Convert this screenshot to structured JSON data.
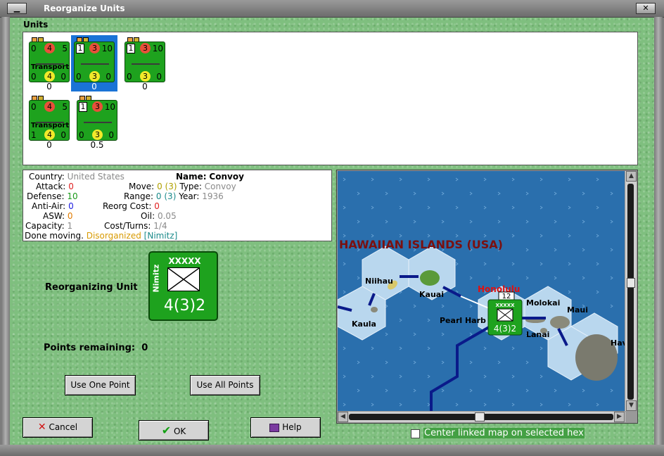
{
  "window": {
    "title": "Reorganize Units",
    "minimize_glyph": "▁",
    "close_glyph": "✕"
  },
  "units": {
    "label": "Units",
    "counters": [
      {
        "top_left": "0",
        "attack": "4",
        "move": "5",
        "name": "Transport",
        "bottom_left": "0",
        "defense": "4",
        "bottom_right": "0",
        "value": "0",
        "boxed": false,
        "selected": false
      },
      {
        "top_left": "1",
        "attack": "3",
        "move": "10",
        "name": "",
        "bottom_left": "0",
        "defense": "3",
        "bottom_right": "0",
        "value": "0",
        "boxed": true,
        "selected": true
      },
      {
        "top_left": "1",
        "attack": "3",
        "move": "10",
        "name": "",
        "bottom_left": "0",
        "defense": "3",
        "bottom_right": "0",
        "value": "0",
        "boxed": true,
        "selected": false
      },
      {
        "top_left": "0",
        "attack": "4",
        "move": "5",
        "name": "Transport",
        "bottom_left": "1",
        "defense": "4",
        "bottom_right": "0",
        "value": "0",
        "boxed": false,
        "selected": false
      },
      {
        "top_left": "1",
        "attack": "3",
        "move": "10",
        "name": "",
        "bottom_left": "0",
        "defense": "3",
        "bottom_right": "0",
        "value": "0.5",
        "boxed": true,
        "selected": false
      }
    ]
  },
  "info": {
    "country_label": "Country:",
    "country": "United States",
    "attack_label": "Attack:",
    "attack": "0",
    "defense_label": "Defense:",
    "defense": "10",
    "antiair_label": "Anti-Air:",
    "antiair": "0",
    "asw_label": "ASW:",
    "asw": "0",
    "capacity_label": "Capacity:",
    "capacity": "1",
    "status_text": "Done moving.",
    "status_org": "Disorganized",
    "status_leader": "[Nimitz]",
    "name_label": "Name:",
    "name": "Convoy",
    "move_label": "Move:",
    "move": "0",
    "move_paren": "(3)",
    "range_label": "Range:",
    "range": "0",
    "range_paren": "(3)",
    "reorg_label": "Reorg Cost:",
    "reorg": "0",
    "oil_label": "Oil:",
    "oil": "0.05",
    "cost_label": "Cost/Turns:",
    "cost": "1/4",
    "type_label": "Type:",
    "type": "Convoy",
    "year_label": "Year:",
    "year": "1936"
  },
  "reorganizing": {
    "label": "Reorganizing Unit",
    "counter_top": "XXXXX",
    "counter_side": "Nimitz",
    "counter_bottom": "4(3)2"
  },
  "points": {
    "label": "Points remaining:",
    "value": "0"
  },
  "buttons": {
    "use_one": "Use One Point",
    "use_all": "Use All Points",
    "cancel": "Cancel",
    "ok": "OK",
    "help": "Help"
  },
  "map": {
    "region_title": "HAWAIIAN ISLANDS (USA)",
    "labels": {
      "niihau": "Niihau",
      "kauai": "Kauai",
      "kaula": "Kaula",
      "honolulu": "Honolulu",
      "pearl": "Pearl Harb",
      "molokai": "Molokai",
      "maui": "Maui",
      "lanai": "Lanai",
      "hawaii": "Hav"
    },
    "stack_count": "12",
    "unit_top": "XXXXX",
    "unit_bottom": "4(3)2",
    "ocean_color": "#2a6fad",
    "hex_color": "#b9d7ee"
  },
  "center_checkbox": {
    "label": "Center linked map on selected hex",
    "checked": false
  },
  "colors": {
    "accent": "#1a73d6",
    "counter_green": "#1ea21e",
    "attack_red": "#e8503a",
    "defense_yellow": "#f2e92a"
  }
}
